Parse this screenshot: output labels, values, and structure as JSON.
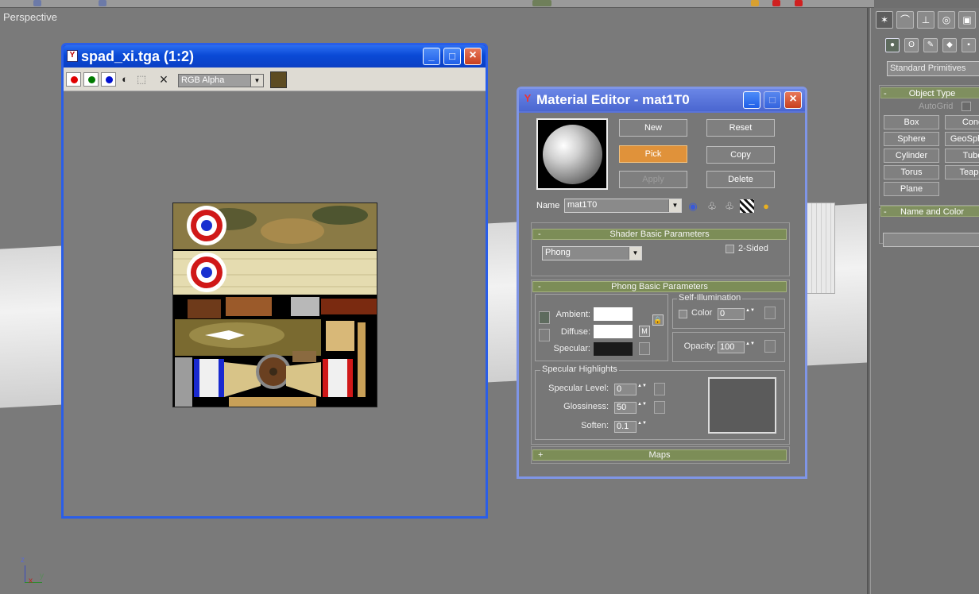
{
  "viewport": {
    "label": "Perspective",
    "axis": {
      "z": "z",
      "x": "x",
      "y": "y"
    }
  },
  "command_panel": {
    "tabs": [
      "create-tab",
      "modify-tab",
      "hierarchy-tab",
      "motion-tab",
      "display-tab"
    ],
    "primitives_type": "Standard Primitives",
    "object_type": {
      "header": "Object Type",
      "toggle": "-",
      "autogrid": "AutoGrid",
      "buttons": [
        "Box",
        "Cone",
        "Sphere",
        "GeoSphere",
        "Cylinder",
        "Tube",
        "Torus",
        "Teapot",
        "Plane"
      ]
    },
    "name_color": {
      "header": "Name and Color",
      "toggle": "-"
    }
  },
  "bitmap_window": {
    "title": "spad_xi.tga (1:2)",
    "channel": "RGB Alpha",
    "swatch_color": "#5d4c22",
    "close_glyph": "×"
  },
  "material_editor": {
    "title": "Material Editor - mat1T0",
    "buttons": {
      "new": "New",
      "reset": "Reset",
      "pick": "Pick",
      "copy": "Copy",
      "apply": "Apply",
      "delete": "Delete"
    },
    "name_label": "Name",
    "name_value": "mat1T0",
    "shader_rollout": {
      "title": "Shader Basic Parameters",
      "toggle": "-",
      "shader": "Phong",
      "two_sided": "2-Sided"
    },
    "phong_rollout": {
      "title": "Phong Basic Parameters",
      "toggle": "-",
      "ambient": "Ambient:",
      "diffuse": "Diffuse:",
      "specular": "Specular:",
      "map_button": "M",
      "self_illum_title": "Self-Illumination",
      "self_illum_color": "Color",
      "self_illum_value": "0",
      "opacity_label": "Opacity:",
      "opacity_value": "100",
      "ambient_color": "#ffffff",
      "diffuse_color": "#ffffff",
      "specular_color": "#1a1a1a"
    },
    "specular_highlights": {
      "title": "Specular Highlights",
      "level_label": "Specular Level:",
      "level_value": "0",
      "gloss_label": "Glossiness:",
      "gloss_value": "50",
      "soften_label": "Soften:",
      "soften_value": "0.1"
    },
    "maps_rollout": {
      "title": "Maps",
      "toggle": "+"
    }
  }
}
